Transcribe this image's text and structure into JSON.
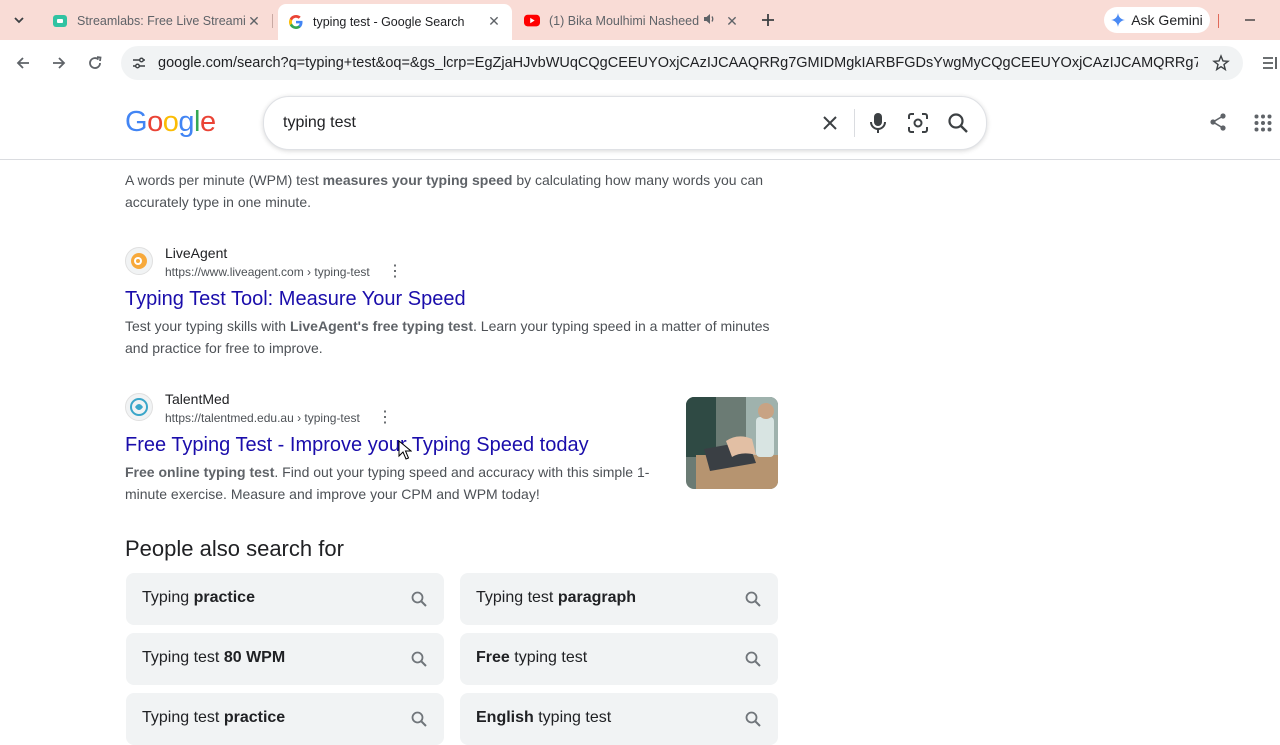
{
  "tabs": [
    {
      "title": "Streamlabs: Free Live Streaming",
      "icon": "streamlabs-icon"
    },
    {
      "title": "typing test - Google Search",
      "icon": "google-g-icon"
    },
    {
      "title": "(1) Bika Moulhimi Nasheed",
      "icon": "youtube-icon"
    }
  ],
  "ask_gemini": "Ask Gemini",
  "address_bar": {
    "url": "google.com/search?q=typing+test&oq=&gs_lcrp=EgZjaHJvbWUqCQgCEEUYOxjCAzIJCAAQRRg7GMIDMgkIARBFGDsYwgMyCQgCEEUYOxjCAzIJCAMQRRg7GMIDMgkI..."
  },
  "search": {
    "query": "typing test"
  },
  "logo": {
    "letters": [
      "G",
      "o",
      "o",
      "g",
      "l",
      "e"
    ],
    "colors": [
      "#4285f4",
      "#ea4335",
      "#fbbc05",
      "#4285f4",
      "#34a853",
      "#ea4335"
    ]
  },
  "results": [
    {
      "partial_title": "measures your typing speed",
      "snippet_parts": [
        {
          "t": "A words per minute (WPM) test ",
          "b": false
        },
        {
          "t": "measures your typing speed",
          "b": true
        },
        {
          "t": " by calculating how many words you can accurately type in one minute.",
          "b": false
        }
      ]
    },
    {
      "site": "LiveAgent",
      "cite": "https://www.liveagent.com › typing-test",
      "title": "Typing Test Tool: Measure Your Speed",
      "snippet_parts": [
        {
          "t": "Test your typing skills with ",
          "b": false
        },
        {
          "t": "LiveAgent's free typing test",
          "b": true
        },
        {
          "t": ". Learn your typing speed in a matter of minutes and practice for free to improve.",
          "b": false
        }
      ]
    },
    {
      "site": "TalentMed",
      "cite": "https://talentmed.edu.au › typing-test",
      "title": "Free Typing Test - Improve your Typing Speed today",
      "snippet_parts": [
        {
          "t": "Free online typing test",
          "b": true
        },
        {
          "t": ". Find out your typing speed and accuracy with this simple 1-minute exercise. Measure and improve your CPM and WPM today!",
          "b": false
        }
      ]
    }
  ],
  "people_also_search": {
    "heading": "People also search for",
    "chips": [
      {
        "plain_before": "Typing ",
        "bold": "practice",
        "plain_after": ""
      },
      {
        "plain_before": "Typing test ",
        "bold": "paragraph",
        "plain_after": ""
      },
      {
        "plain_before": "Typing test ",
        "bold": "80 WPM",
        "plain_after": ""
      },
      {
        "plain_before": "",
        "bold": "Free",
        "plain_after": " typing test"
      },
      {
        "plain_before": "Typing test ",
        "bold": "practice",
        "plain_after": ""
      },
      {
        "plain_before": "",
        "bold": "English",
        "plain_after": " typing test"
      }
    ]
  }
}
